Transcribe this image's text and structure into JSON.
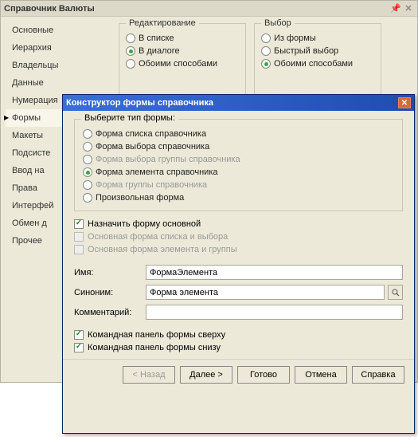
{
  "bg": {
    "title": "Справочник Валюты",
    "tabs": [
      "Основные",
      "Иерархия",
      "Владельцы",
      "Данные",
      "Нумерация",
      "Формы",
      "Макеты",
      "Подсисте",
      "Ввод на",
      "Права",
      "Интерфей",
      "Обмен д",
      "Прочее"
    ],
    "active_tab_index": 5,
    "group_edit": {
      "legend": "Редактирование",
      "options": [
        "В списке",
        "В диалоге",
        "Обоими способами"
      ],
      "selected_index": 1
    },
    "group_select": {
      "legend": "Выбор",
      "options": [
        "Из формы",
        "Быстрый выбор",
        "Обоими способами"
      ],
      "selected_index": 2
    }
  },
  "dialog": {
    "title": "Конструктор формы справочника",
    "types_legend": "Выберите тип формы:",
    "types": [
      {
        "label": "Форма списка справочника",
        "enabled": true,
        "checked": false
      },
      {
        "label": "Форма выбора справочника",
        "enabled": true,
        "checked": false
      },
      {
        "label": "Форма выбора группы справочника",
        "enabled": false,
        "checked": false
      },
      {
        "label": "Форма элемента справочника",
        "enabled": true,
        "checked": true
      },
      {
        "label": "Форма группы справочника",
        "enabled": false,
        "checked": false
      },
      {
        "label": "Произвольная форма",
        "enabled": true,
        "checked": false
      }
    ],
    "chk_main": {
      "label": "Назначить форму основной",
      "checked": true,
      "enabled": true
    },
    "chk_list": {
      "label": "Основная форма списка и выбора",
      "checked": false,
      "enabled": false
    },
    "chk_elem_group": {
      "label": "Основная форма элемента и группы",
      "checked": false,
      "enabled": false
    },
    "name_label": "Имя:",
    "name_value": "ФормаЭлемента",
    "syn_label": "Синоним:",
    "syn_value": "Форма элемента",
    "comment_label": "Комментарий:",
    "comment_value": "",
    "chk_top": {
      "label": "Командная панель формы сверху",
      "checked": true,
      "enabled": true
    },
    "chk_bottom": {
      "label": "Командная панель формы снизу",
      "checked": true,
      "enabled": true
    },
    "buttons": {
      "back": "< Назад",
      "next": "Далее >",
      "finish": "Готово",
      "cancel": "Отмена",
      "help": "Справка"
    }
  }
}
